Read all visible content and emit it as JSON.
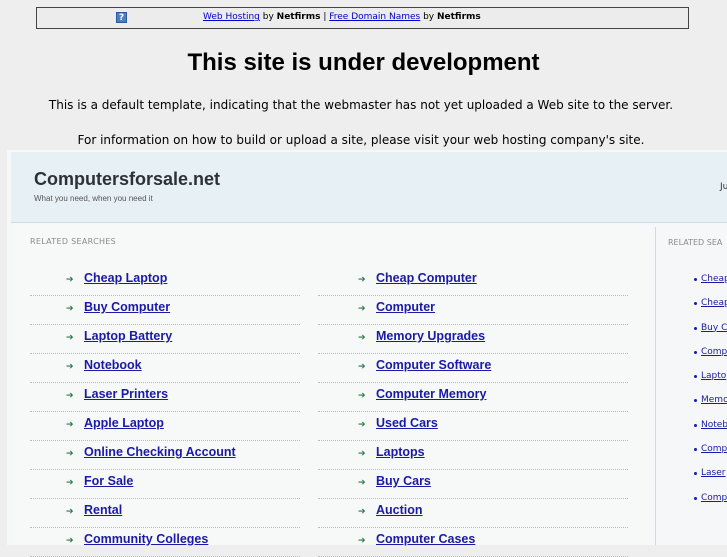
{
  "topbar": {
    "icon": "question-icon",
    "icon_glyph": "?",
    "link1": "Web Hosting",
    "by1": " by ",
    "brand1": "Netfirms",
    "sep": " | ",
    "link2": "Free Domain Names",
    "by2": " by ",
    "brand2": "Netfirms"
  },
  "title": "This site is under development",
  "note1": "This is a default template, indicating that the webmaster has not yet uploaded a Web site to the server.",
  "note2": "For information on how to build or upload a site, please visit your web hosting company's site.",
  "site": {
    "name": "Computersforsale.net",
    "tagline": "What you need, when you need it",
    "ju": "Ju"
  },
  "related": {
    "label": "RELATED SEARCHES",
    "col1": [
      "Cheap Laptop",
      "Buy Computer",
      "Laptop Battery",
      "Notebook",
      "Laser Printers",
      "Apple Laptop",
      "Online Checking Account",
      "For Sale",
      "Rental",
      "Community Colleges"
    ],
    "col2": [
      "Cheap Computer",
      "Computer",
      "Memory Upgrades",
      "Computer Software",
      "Computer Memory",
      "Used Cars",
      "Laptops",
      "Buy Cars",
      "Auction",
      "Computer Cases"
    ]
  },
  "side": {
    "label": "RELATED SEA",
    "items": [
      "Cheap",
      "Cheap",
      "Buy C",
      "Comp",
      "Lapto",
      "Memo",
      "Noteb",
      "Comp",
      "Laser",
      "Comp"
    ]
  },
  "arrow_glyph": "➔"
}
